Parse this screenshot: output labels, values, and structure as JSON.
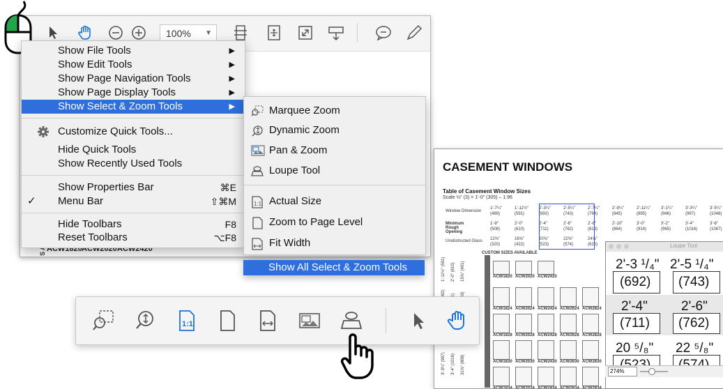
{
  "toolbar": {
    "zoom_value": "100%"
  },
  "menu": {
    "items": [
      {
        "label": "Show File Tools"
      },
      {
        "label": "Show Edit Tools"
      },
      {
        "label": "Show Page Navigation Tools"
      },
      {
        "label": "Show Page Display Tools"
      },
      {
        "label": "Show Select & Zoom Tools"
      },
      {
        "label": "Customize Quick Tools..."
      },
      {
        "label": "Hide Quick Tools"
      },
      {
        "label": "Show Recently Used Tools"
      },
      {
        "label": "Show Properties Bar",
        "shortcut": "⌘E"
      },
      {
        "label": "Menu Bar",
        "shortcut": "⇧⌘M",
        "check": "✓"
      },
      {
        "label": "Hide Toolbars",
        "shortcut": "F8"
      },
      {
        "label": "Reset Toolbars",
        "shortcut": "⌥F8"
      }
    ]
  },
  "submenu": {
    "items": [
      {
        "label": "Marquee Zoom"
      },
      {
        "label": "Dynamic Zoom"
      },
      {
        "label": "Pan & Zoom"
      },
      {
        "label": "Loupe Tool"
      },
      {
        "label": "Actual Size"
      },
      {
        "label": "Zoom to Page Level"
      },
      {
        "label": "Fit Width"
      },
      {
        "label": "Show All Select & Zoom Tools"
      }
    ]
  },
  "bg_page": {
    "labels": [
      "ACW1820",
      "ACW2020",
      "ACW2420"
    ],
    "side_text": [
      "151",
      "(4",
      "S AVAIL"
    ]
  },
  "doc": {
    "title": "CASEMENT WINDOWS",
    "subtitle": "Table of Casement Window Sizes",
    "scale": "Scale ⅛\" (3) = 1'-0\" (305) – 1:96",
    "row_labels": [
      "Window Dimension",
      "Minimum Rough Opening",
      "Unobstructed Glass"
    ],
    "custom_sizes": "CUSTOM SIZES AVAILABLE",
    "col_dims": [
      "1'-7¼\"",
      "1'-11½\"",
      "2'-3¼\"",
      "2'-5¼\"",
      "2'-7¼\"",
      "2'-9¼\"",
      "2'-11¼\"",
      "3'-1¼\"",
      "3'-3¼\"",
      "3'-5¼\""
    ],
    "col_mm": [
      "(489)",
      "(591)",
      "(692)",
      "(743)",
      "(794)",
      "(845)",
      "(895)",
      "(946)",
      "(997)",
      "(1048)"
    ],
    "rough_dims": [
      "1'-8\"",
      "2'-0\"",
      "2'-4\"",
      "2'-6\"",
      "2'-8\"",
      "2'-10\"",
      "3'-0\"",
      "3'-2\"",
      "3'-4\"",
      "3'-6\""
    ],
    "rough_mm": [
      "(508)",
      "(610)",
      "(711)",
      "(762)",
      "(813)",
      "(864)",
      "(914)",
      "(965)",
      "(1016)",
      "(1067)"
    ],
    "glass_dims": [
      "12⅝\"",
      "16⅝\"",
      "20⅝\"",
      "22⅝\"",
      "24⅝\""
    ],
    "glass_mm": [
      "(320)",
      "(422)",
      "(523)",
      "(574)",
      "(625)"
    ],
    "row1": [
      "ACW1820",
      "ACW2020",
      "ACW2420"
    ],
    "row2": [
      "ACW1824",
      "ACW2024",
      "ACW2424",
      "ACW2624",
      "ACW2824"
    ],
    "row3": [
      "ACW1828",
      "ACW2028",
      "ACW2428",
      "ACW2628",
      "ACW2828"
    ],
    "row4": [
      "ACW1830",
      "ACW2030",
      "ACW2430",
      "ACW2630",
      "ACW2830"
    ],
    "row5": [
      "ACW1834",
      "ACW2034",
      "ACW2434",
      "ACW2634",
      "ACW2834"
    ],
    "left_dims": [
      "1'-11½\" (591)",
      "2'-0\" (610)",
      "15⅝\" (401)",
      "2'-3¼\" (692)",
      "2'-4\" (711)",
      "19⅝\" (503)",
      "3'-3¼\" (997)",
      "3'-4\" (1016)",
      "31⅝\" (808)"
    ]
  },
  "loupe": {
    "title": "Loupe Tool",
    "zoom": "274%",
    "dims": [
      "2'-3 ¹/₄\"",
      "2'-5 ¹/₄\""
    ],
    "mm1": [
      "(692)",
      "(743)"
    ],
    "rough": [
      "2'-4\"",
      "2'-6\""
    ],
    "mm2": [
      "(711)",
      "(762)"
    ],
    "glass": [
      "20 ⁵/₈\"",
      "22 ⁵/₈\""
    ],
    "mm3": [
      "(523)",
      "(574)"
    ]
  },
  "colors": {
    "accent": "#2e6fdd",
    "icon_blue": "#1a73d9",
    "green": "#22a64a"
  }
}
